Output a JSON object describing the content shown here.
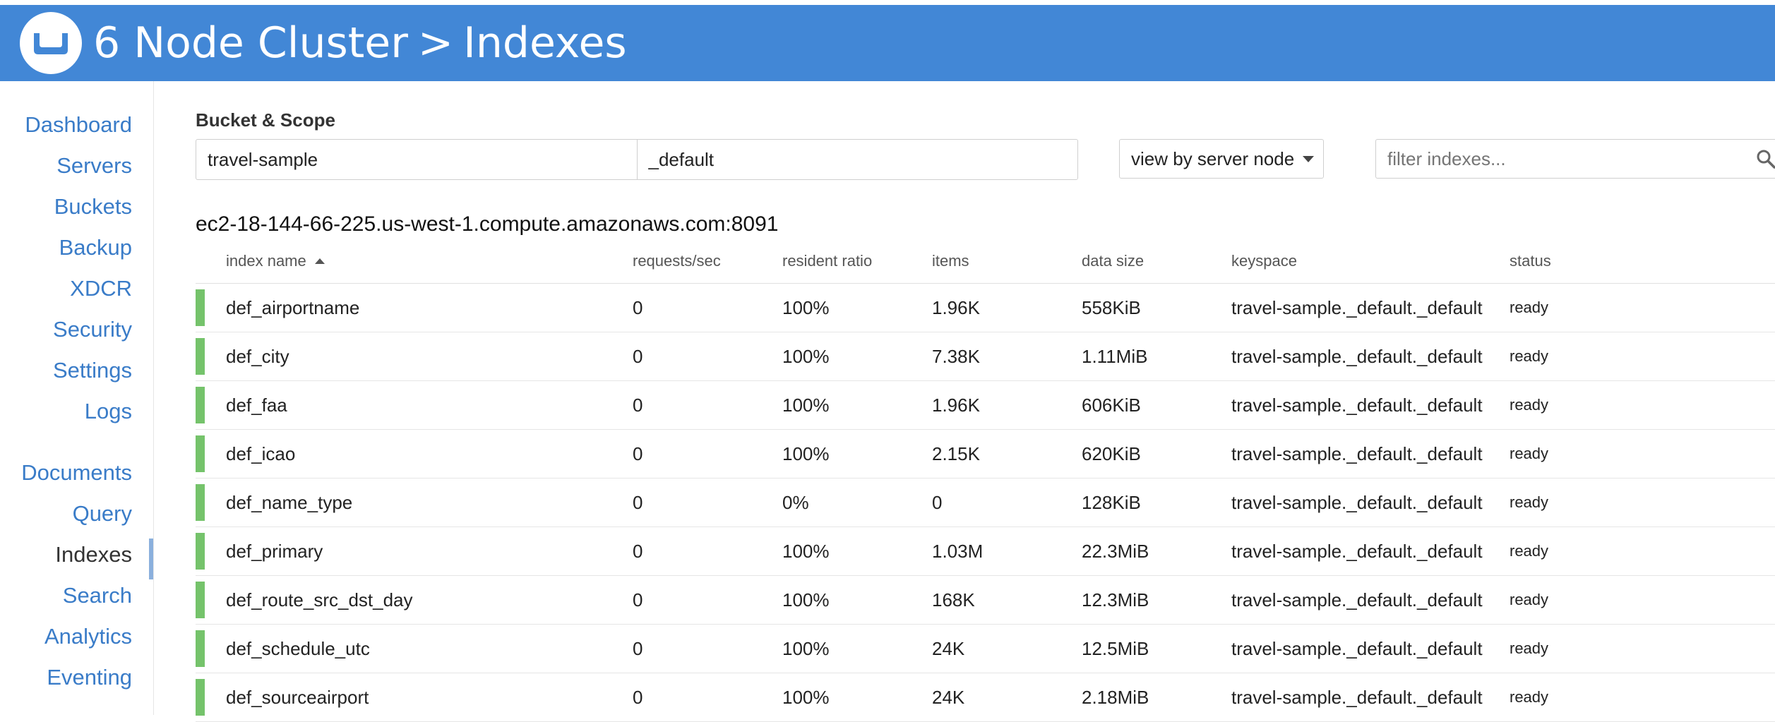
{
  "header": {
    "cluster_name": "6 Node Cluster",
    "separator": ">",
    "page_title": "Indexes"
  },
  "icons": {
    "logo": "couchbase-logo-icon",
    "search": "search-icon",
    "dropdown": "caret-down-icon",
    "sort": "sort-ascending-icon"
  },
  "colors": {
    "header_bg": "#4287d6",
    "nav_link": "#3a7cc8",
    "status_ready": "#75c36b"
  },
  "sidebar": {
    "items": [
      {
        "label": "Dashboard"
      },
      {
        "label": "Servers"
      },
      {
        "label": "Buckets"
      },
      {
        "label": "Backup"
      },
      {
        "label": "XDCR"
      },
      {
        "label": "Security"
      },
      {
        "label": "Settings"
      },
      {
        "label": "Logs"
      },
      {
        "label": "Documents"
      },
      {
        "label": "Query"
      },
      {
        "label": "Indexes"
      },
      {
        "label": "Search"
      },
      {
        "label": "Analytics"
      },
      {
        "label": "Eventing"
      }
    ],
    "active": "Indexes"
  },
  "filters": {
    "bucket_scope_label": "Bucket & Scope",
    "bucket": "travel-sample",
    "scope": "_default",
    "view_by": "view by server node",
    "filter_placeholder": "filter indexes..."
  },
  "server": {
    "host": "ec2-18-144-66-225.us-west-1.compute.amazonaws.com:8091"
  },
  "table": {
    "columns": [
      "index name",
      "requests/sec",
      "resident ratio",
      "items",
      "data size",
      "keyspace",
      "status"
    ],
    "rows": [
      [
        "def_airportname",
        "0",
        "100%",
        "1.96K",
        "558KiB",
        "travel-sample._default._default",
        "ready"
      ],
      [
        "def_city",
        "0",
        "100%",
        "7.38K",
        "1.11MiB",
        "travel-sample._default._default",
        "ready"
      ],
      [
        "def_faa",
        "0",
        "100%",
        "1.96K",
        "606KiB",
        "travel-sample._default._default",
        "ready"
      ],
      [
        "def_icao",
        "0",
        "100%",
        "2.15K",
        "620KiB",
        "travel-sample._default._default",
        "ready"
      ],
      [
        "def_name_type",
        "0",
        "0%",
        "0",
        "128KiB",
        "travel-sample._default._default",
        "ready"
      ],
      [
        "def_primary",
        "0",
        "100%",
        "1.03M",
        "22.3MiB",
        "travel-sample._default._default",
        "ready"
      ],
      [
        "def_route_src_dst_day",
        "0",
        "100%",
        "168K",
        "12.3MiB",
        "travel-sample._default._default",
        "ready"
      ],
      [
        "def_schedule_utc",
        "0",
        "100%",
        "24K",
        "12.5MiB",
        "travel-sample._default._default",
        "ready"
      ],
      [
        "def_sourceairport",
        "0",
        "100%",
        "24K",
        "2.18MiB",
        "travel-sample._default._default",
        "ready"
      ]
    ]
  }
}
